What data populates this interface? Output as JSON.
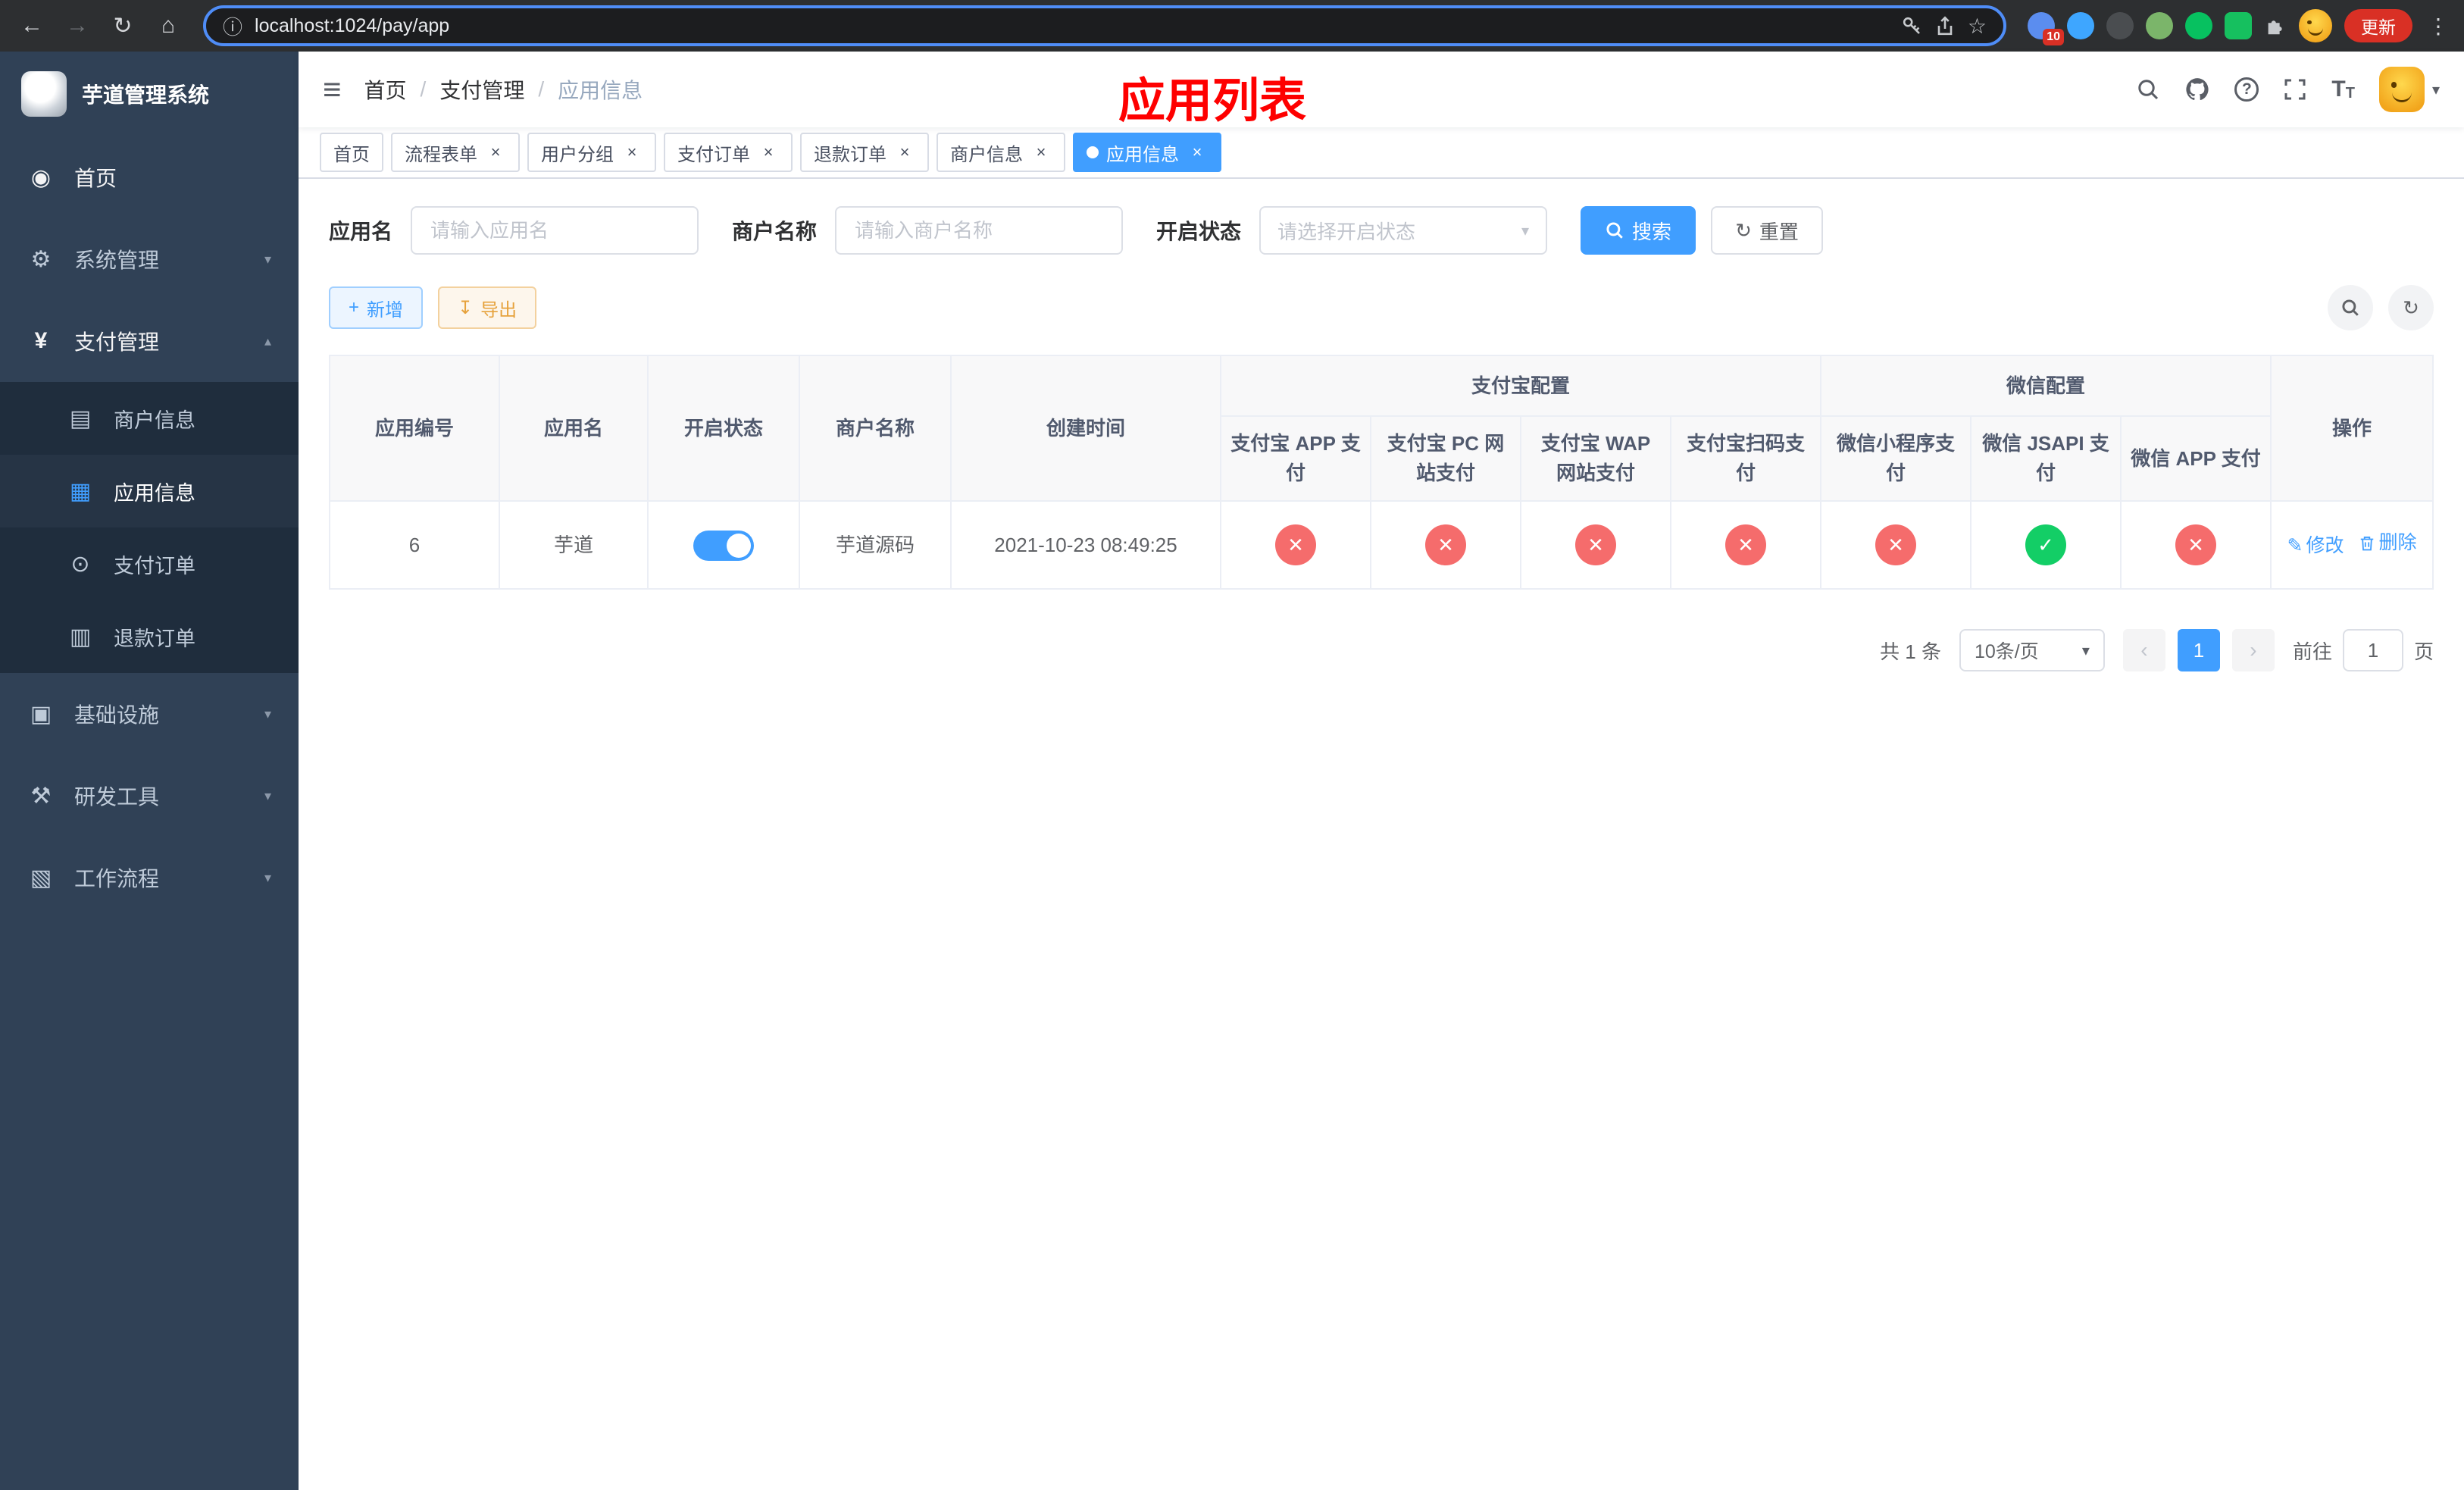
{
  "colors": {
    "primary": "#409eff",
    "success": "#13ce66",
    "danger": "#f56c6c",
    "sidebar_bg": "#304156",
    "annotation_red": "#fe0000"
  },
  "glyphs": {
    "check": "✓",
    "cross": "✕"
  },
  "icons": {
    "back": "←",
    "forward": "→",
    "reload": "↻",
    "home": "⌂",
    "info": "ⓘ",
    "star": "☆",
    "kebab": "⋮",
    "hamburger": "≡",
    "caret_down": "▾",
    "caret_up": "▴",
    "question": "?",
    "size_big": "T",
    "size_small": "T",
    "menu_dashboard": "◉",
    "menu_gear": "⚙",
    "menu_yen": "¥",
    "menu_card": "▤",
    "menu_grid": "▦",
    "menu_order": "⊙",
    "menu_refund": "▥",
    "menu_infra": "▣",
    "menu_tool": "⚒",
    "menu_flow": "▧",
    "plus": "+",
    "download": "↧",
    "refresh": "↻",
    "edit": "✎",
    "prev": "‹",
    "next": "›"
  },
  "browser": {
    "url": "localhost:1024/pay/app",
    "update_button": "更新",
    "extension_badge": "10"
  },
  "sidebar": {
    "app_title": "芋道管理系统",
    "home": "首页",
    "system": "系统管理",
    "payment": "支付管理",
    "merchant_info": "商户信息",
    "app_info": "应用信息",
    "pay_order": "支付订单",
    "refund_order": "退款订单",
    "infra": "基础设施",
    "dev": "研发工具",
    "workflow": "工作流程"
  },
  "breadcrumb": [
    "首页",
    "支付管理",
    "应用信息"
  ],
  "annotation": "应用列表",
  "tabs": [
    {
      "label": "首页",
      "closable": false,
      "active": false
    },
    {
      "label": "流程表单",
      "closable": true,
      "active": false
    },
    {
      "label": "用户分组",
      "closable": true,
      "active": false
    },
    {
      "label": "支付订单",
      "closable": true,
      "active": false
    },
    {
      "label": "退款订单",
      "closable": true,
      "active": false
    },
    {
      "label": "商户信息",
      "closable": true,
      "active": false
    },
    {
      "label": "应用信息",
      "closable": true,
      "active": true
    }
  ],
  "tab_close": "×",
  "filters": {
    "app_name_label": "应用名",
    "app_name_placeholder": "请输入应用名",
    "merchant_label": "商户名称",
    "merchant_placeholder": "请输入商户名称",
    "status_label": "开启状态",
    "status_placeholder": "请选择开启状态",
    "search": "搜索",
    "reset": "重置"
  },
  "toolbar": {
    "add": "新增",
    "export": "导出"
  },
  "table": {
    "headers": {
      "app_id": "应用编号",
      "app_name": "应用名",
      "status": "开启状态",
      "merchant_name": "商户名称",
      "create_time": "创建时间",
      "alipay_group": "支付宝配置",
      "wechat_group": "微信配置",
      "actions": "操作",
      "alipay_app": "支付宝 APP 支付",
      "alipay_pc": "支付宝 PC 网站支付",
      "alipay_wap": "支付宝 WAP 网站支付",
      "alipay_qr": "支付宝扫码支付",
      "wechat_lite": "微信小程序支付",
      "wechat_jsapi": "微信 JSAPI 支付",
      "wechat_app": "微信 APP 支付"
    },
    "row": {
      "app_id": "6",
      "app_name": "芋道",
      "status_on": true,
      "merchant_name": "芋道源码",
      "create_time": "2021-10-23 08:49:25",
      "configs": {
        "alipay_app": false,
        "alipay_pc": false,
        "alipay_wap": false,
        "alipay_qr": false,
        "wechat_lite": false,
        "wechat_jsapi": true,
        "wechat_app": false
      },
      "edit": "修改",
      "delete": "删除"
    }
  },
  "pagination": {
    "total": "共 1 条",
    "page_size": "10条/页",
    "current_page": "1",
    "goto_label": "前往",
    "goto_value": "1",
    "goto_suffix": "页"
  }
}
